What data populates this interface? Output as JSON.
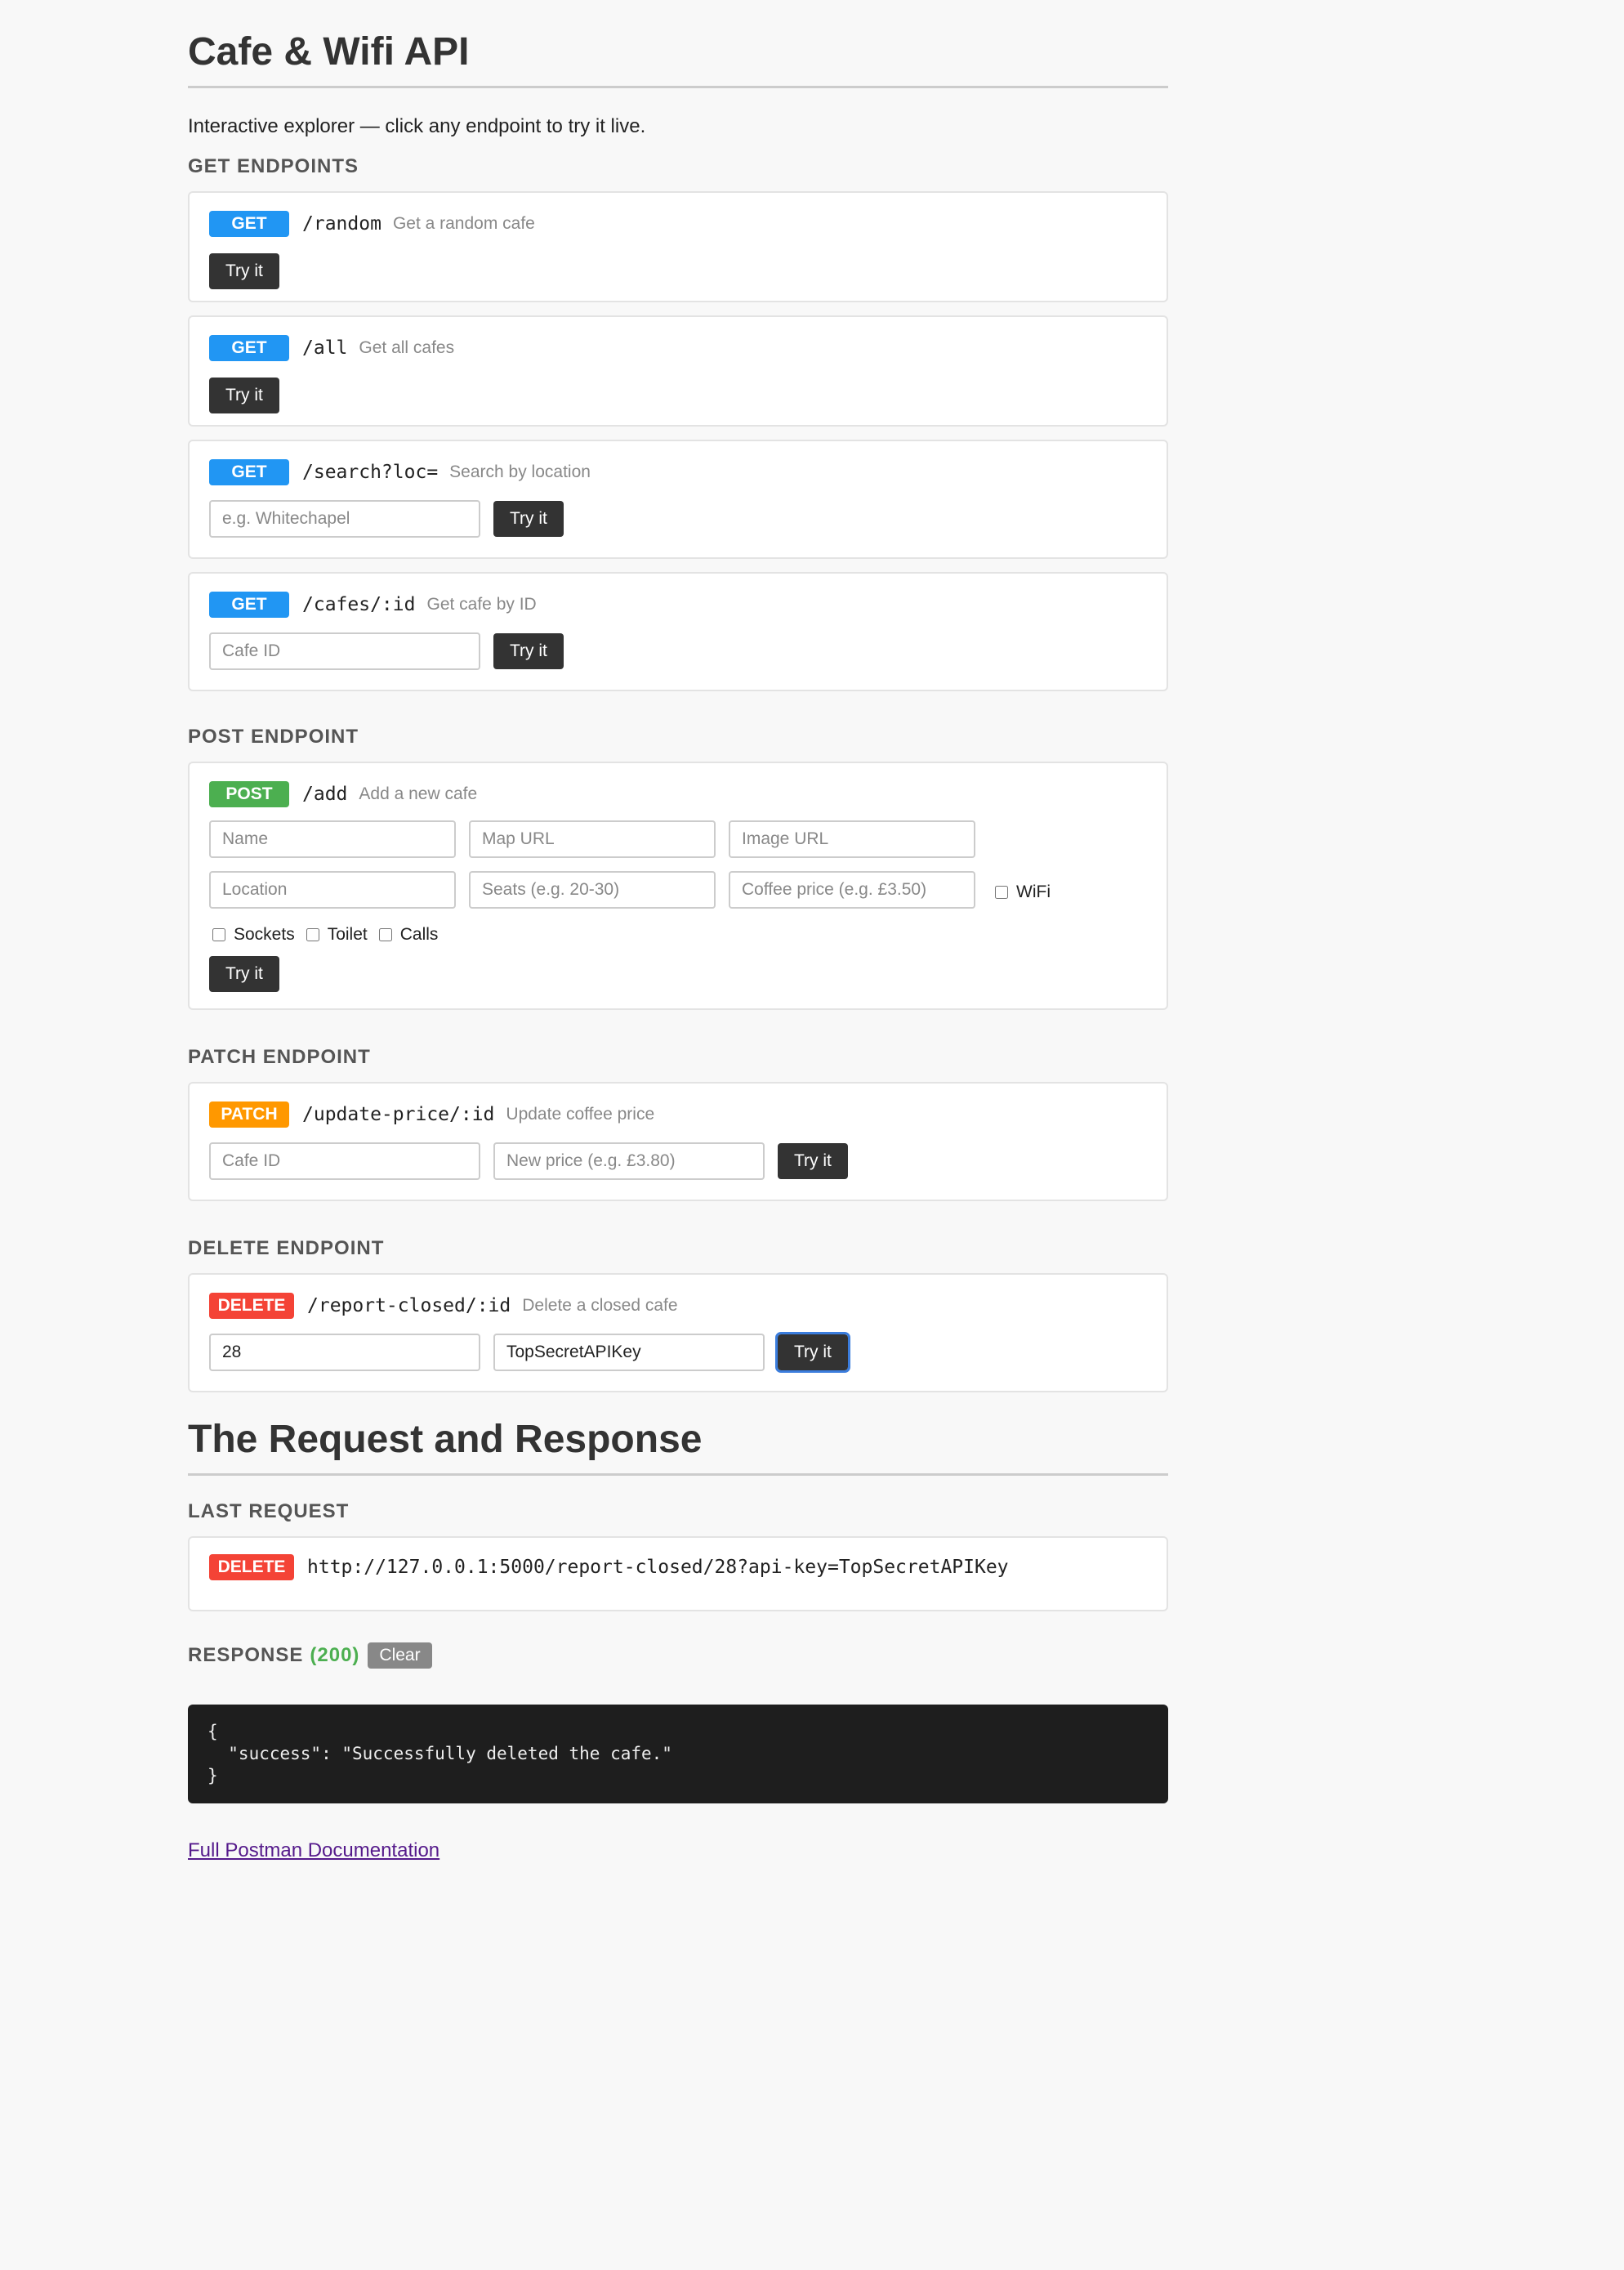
{
  "page": {
    "title": "Cafe & Wifi API",
    "intro": "Interactive explorer — click any endpoint to try it live."
  },
  "sections": {
    "get": "GET ENDPOINTS",
    "post": "POST ENDPOINT",
    "patch": "PATCH ENDPOINT",
    "delete": "DELETE ENDPOINT"
  },
  "try_label": "Try it",
  "get_endpoints": [
    {
      "method": "GET",
      "path": "/random",
      "desc": "Get a random cafe"
    },
    {
      "method": "GET",
      "path": "/all",
      "desc": "Get all cafes"
    },
    {
      "method": "GET",
      "path": "/search?loc=",
      "desc": "Search by location",
      "input_placeholder": "e.g. Whitechapel",
      "input_value": ""
    },
    {
      "method": "GET",
      "path": "/cafes/:id",
      "desc": "Get cafe by ID",
      "input_placeholder": "Cafe ID",
      "input_value": ""
    }
  ],
  "post_endpoint": {
    "method": "POST",
    "path": "/add",
    "desc": "Add a new cafe",
    "fields": {
      "name": "Name",
      "map_url": "Map URL",
      "image_url": "Image URL",
      "location": "Location",
      "seats": "Seats (e.g. 20-30)",
      "coffee_price": "Coffee price (e.g. £3.50)"
    },
    "checkboxes": {
      "wifi": "WiFi",
      "sockets": "Sockets",
      "toilet": "Toilet",
      "calls": "Calls"
    }
  },
  "patch_endpoint": {
    "method": "PATCH",
    "path": "/update-price/:id",
    "desc": "Update coffee price",
    "id_placeholder": "Cafe ID",
    "price_placeholder": "New price (e.g. £3.80)"
  },
  "delete_endpoint": {
    "method": "DELETE",
    "path": "/report-closed/:id",
    "desc": "Delete a closed cafe",
    "id_value": "28",
    "api_key_value": "TopSecretAPIKey"
  },
  "request_section": {
    "title": "The Request and Response",
    "last_request_label": "LAST REQUEST",
    "method": "DELETE",
    "url": "http://127.0.0.1:5000/report-closed/28?api-key=TopSecretAPIKey"
  },
  "response": {
    "label": "RESPONSE",
    "status": "(200)",
    "clear_label": "Clear",
    "body": "{\n  \"success\": \"Successfully deleted the cafe.\"\n}"
  },
  "footer": {
    "doc_link": "Full Postman Documentation"
  },
  "colors": {
    "get": "#2196f3",
    "post": "#4caf50",
    "patch": "#ff9800",
    "delete": "#f44336",
    "status_ok": "#4caf50"
  }
}
